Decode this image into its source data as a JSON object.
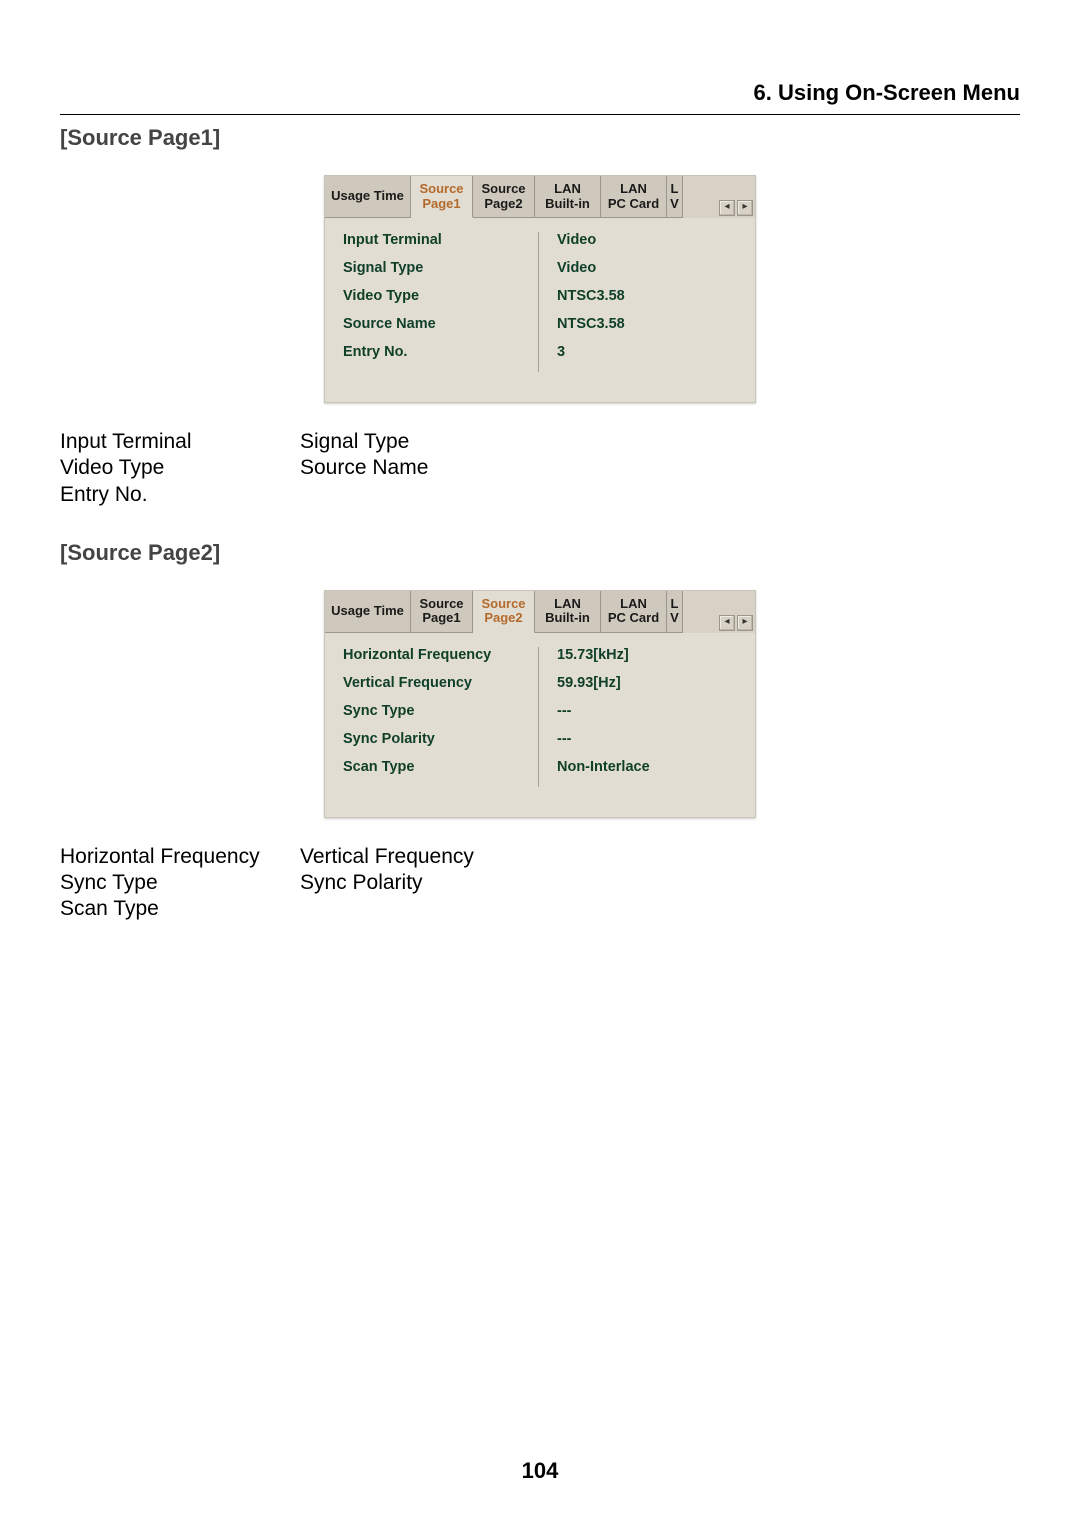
{
  "chapter_title": "6. Using On-Screen Menu",
  "page_number": "104",
  "section1": {
    "heading": "[Source Page1]",
    "screenshot": {
      "tabs": [
        {
          "label": "Usage Time",
          "active": false,
          "cls": "wide0"
        },
        {
          "label": "Source\nPage1",
          "active": true,
          "cls": "wide1"
        },
        {
          "label": "Source\nPage2",
          "active": false,
          "cls": "wide2"
        },
        {
          "label": "LAN\nBuilt-in",
          "active": false,
          "cls": "wide3"
        },
        {
          "label": "LAN\nPC Card",
          "active": false,
          "cls": "wide4"
        },
        {
          "label": "L\nV",
          "active": false,
          "cls": "narrow"
        }
      ],
      "rows": [
        {
          "label": "Input Terminal",
          "value": "Video"
        },
        {
          "label": "Signal Type",
          "value": "Video"
        },
        {
          "label": "Video Type",
          "value": "NTSC3.58"
        },
        {
          "label": "Source Name",
          "value": "NTSC3.58"
        },
        {
          "label": "Entry No.",
          "value": "3"
        }
      ]
    },
    "plain": {
      "col1": [
        "Input Terminal",
        "Video Type",
        "Entry No."
      ],
      "col2": [
        "Signal Type",
        "Source Name"
      ]
    }
  },
  "section2": {
    "heading": "[Source Page2]",
    "screenshot": {
      "tabs": [
        {
          "label": "Usage Time",
          "active": false,
          "cls": "wide0"
        },
        {
          "label": "Source\nPage1",
          "active": false,
          "cls": "wide1"
        },
        {
          "label": "Source\nPage2",
          "active": true,
          "cls": "wide2"
        },
        {
          "label": "LAN\nBuilt-in",
          "active": false,
          "cls": "wide3"
        },
        {
          "label": "LAN\nPC Card",
          "active": false,
          "cls": "wide4"
        },
        {
          "label": "L\nV",
          "active": false,
          "cls": "narrow"
        }
      ],
      "rows": [
        {
          "label": "Horizontal Frequency",
          "value": "15.73[kHz]"
        },
        {
          "label": "Vertical Frequency",
          "value": "59.93[Hz]"
        },
        {
          "label": "Sync Type",
          "value": "---"
        },
        {
          "label": "Sync Polarity",
          "value": "---"
        },
        {
          "label": "Scan Type",
          "value": "Non-Interlace"
        }
      ]
    },
    "plain": {
      "col1": [
        "Horizontal Frequency",
        "Sync Type",
        "Scan Type"
      ],
      "col2": [
        "Vertical Frequency",
        "Sync Polarity"
      ]
    }
  }
}
